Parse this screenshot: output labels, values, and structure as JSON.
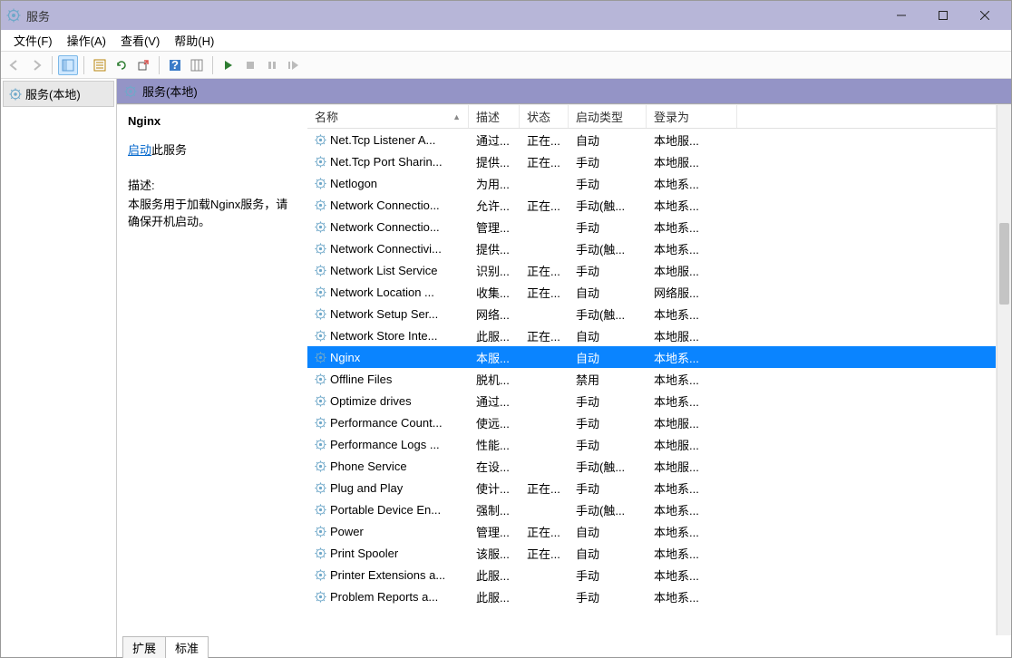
{
  "window": {
    "title": "服务"
  },
  "menu": {
    "file": "文件(F)",
    "action": "操作(A)",
    "view": "查看(V)",
    "help": "帮助(H)"
  },
  "nav": {
    "local": "服务(本地)"
  },
  "content_header": "服务(本地)",
  "detail": {
    "selected_name": "Nginx",
    "start_link": "启动",
    "start_suffix": "此服务",
    "desc_label": "描述:",
    "desc_text": "本服务用于加载Nginx服务，请确保开机启动。"
  },
  "columns": {
    "name": "名称",
    "desc": "描述",
    "status": "状态",
    "startup": "启动类型",
    "logon": "登录为"
  },
  "services": [
    {
      "name": "Net.Tcp Listener A...",
      "desc": "通过...",
      "status": "正在...",
      "startup": "自动",
      "logon": "本地服..."
    },
    {
      "name": "Net.Tcp Port Sharin...",
      "desc": "提供...",
      "status": "正在...",
      "startup": "手动",
      "logon": "本地服..."
    },
    {
      "name": "Netlogon",
      "desc": "为用...",
      "status": "",
      "startup": "手动",
      "logon": "本地系..."
    },
    {
      "name": "Network Connectio...",
      "desc": "允许...",
      "status": "正在...",
      "startup": "手动(触...",
      "logon": "本地系..."
    },
    {
      "name": "Network Connectio...",
      "desc": "管理...",
      "status": "",
      "startup": "手动",
      "logon": "本地系..."
    },
    {
      "name": "Network Connectivi...",
      "desc": "提供...",
      "status": "",
      "startup": "手动(触...",
      "logon": "本地系..."
    },
    {
      "name": "Network List Service",
      "desc": "识别...",
      "status": "正在...",
      "startup": "手动",
      "logon": "本地服..."
    },
    {
      "name": "Network Location ...",
      "desc": "收集...",
      "status": "正在...",
      "startup": "自动",
      "logon": "网络服..."
    },
    {
      "name": "Network Setup Ser...",
      "desc": "网络...",
      "status": "",
      "startup": "手动(触...",
      "logon": "本地系..."
    },
    {
      "name": "Network Store Inte...",
      "desc": "此服...",
      "status": "正在...",
      "startup": "自动",
      "logon": "本地服..."
    },
    {
      "name": "Nginx",
      "desc": "本服...",
      "status": "",
      "startup": "自动",
      "logon": "本地系...",
      "selected": true
    },
    {
      "name": "Offline Files",
      "desc": "脱机...",
      "status": "",
      "startup": "禁用",
      "logon": "本地系..."
    },
    {
      "name": "Optimize drives",
      "desc": "通过...",
      "status": "",
      "startup": "手动",
      "logon": "本地系..."
    },
    {
      "name": "Performance Count...",
      "desc": "使远...",
      "status": "",
      "startup": "手动",
      "logon": "本地服..."
    },
    {
      "name": "Performance Logs ...",
      "desc": "性能...",
      "status": "",
      "startup": "手动",
      "logon": "本地服..."
    },
    {
      "name": "Phone Service",
      "desc": "在设...",
      "status": "",
      "startup": "手动(触...",
      "logon": "本地服..."
    },
    {
      "name": "Plug and Play",
      "desc": "使计...",
      "status": "正在...",
      "startup": "手动",
      "logon": "本地系..."
    },
    {
      "name": "Portable Device En...",
      "desc": "强制...",
      "status": "",
      "startup": "手动(触...",
      "logon": "本地系..."
    },
    {
      "name": "Power",
      "desc": "管理...",
      "status": "正在...",
      "startup": "自动",
      "logon": "本地系..."
    },
    {
      "name": "Print Spooler",
      "desc": "该服...",
      "status": "正在...",
      "startup": "自动",
      "logon": "本地系..."
    },
    {
      "name": "Printer Extensions a...",
      "desc": "此服...",
      "status": "",
      "startup": "手动",
      "logon": "本地系..."
    },
    {
      "name": "Problem Reports a...",
      "desc": "此服...",
      "status": "",
      "startup": "手动",
      "logon": "本地系..."
    }
  ],
  "tabs": {
    "extended": "扩展",
    "standard": "标准"
  }
}
